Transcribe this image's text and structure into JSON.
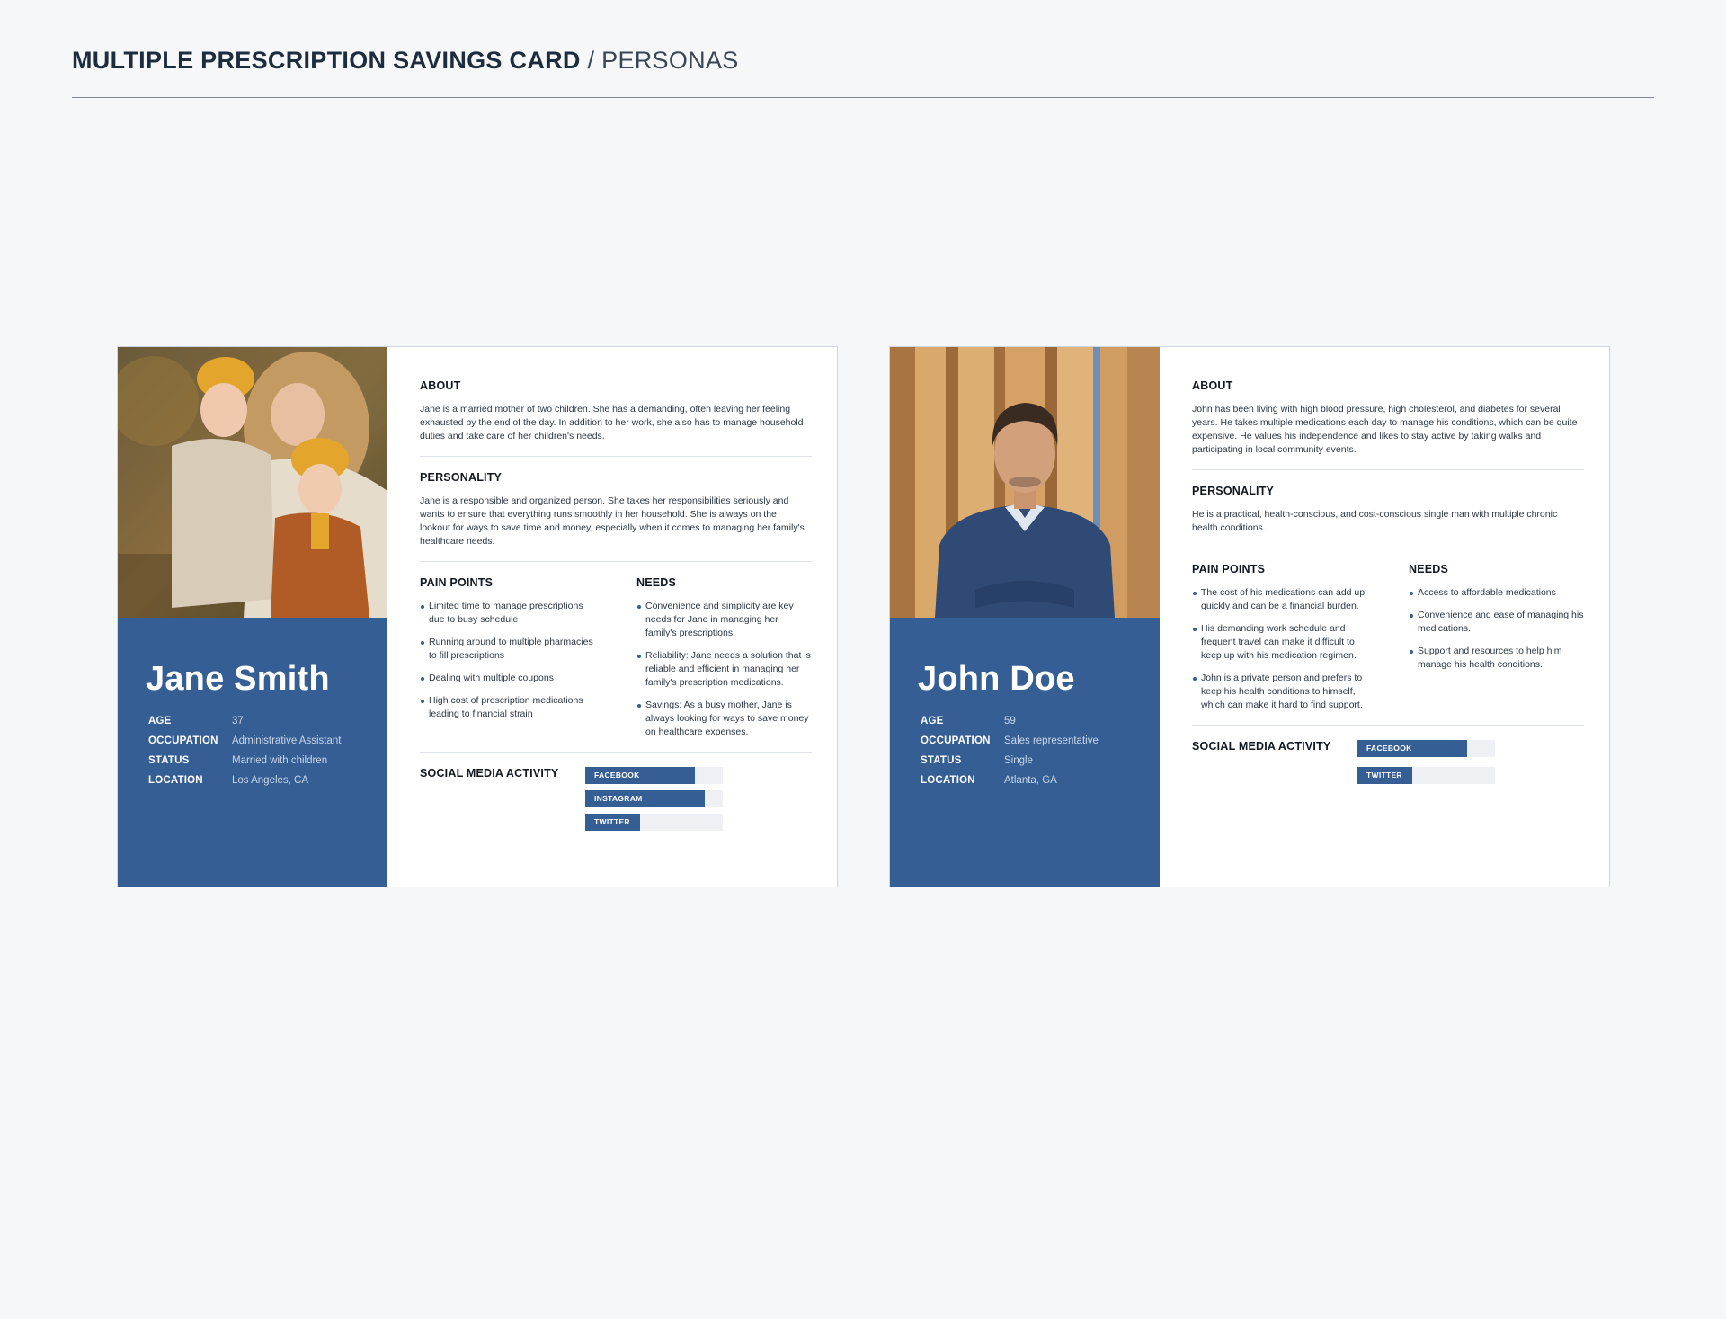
{
  "header": {
    "title_strong": "MULTIPLE PRESCRIPTION SAVINGS CARD",
    "title_light": " / PERSONAS"
  },
  "colors": {
    "accent": "#355e94",
    "background": "#f6f7f9",
    "card": "#ffffff"
  },
  "labels": {
    "age": "AGE",
    "occupation": "OCCUPATION",
    "status": "STATUS",
    "location": "LOCATION",
    "about": "ABOUT",
    "personality": "PERSONALITY",
    "pain_points": "PAIN POINTS",
    "needs": "NEEDS",
    "social": "SOCIAL MEDIA ACTIVITY"
  },
  "personas": [
    {
      "name": "Jane Smith",
      "photo": "mother-with-two-children-photo",
      "age": "37",
      "occupation": "Administrative Assistant",
      "status": "Married with children",
      "location": "Los Angeles, CA",
      "about": "Jane is a married mother of two children. She has a demanding, often leaving her feeling exhausted by the end of the day. In addition to her work, she also has to manage household duties and take care of her children's needs.",
      "personality": "Jane is a responsible and organized person. She takes her responsibilities seriously and wants to ensure that everything runs smoothly in her household. She is always on the lookout for ways to save time and money, especially when it comes to managing her family's healthcare needs.",
      "pain_points": [
        "Limited time to manage prescriptions due to busy schedule",
        "Running around to multiple pharmacies to fill prescriptions",
        "Dealing with multiple coupons",
        "High cost of prescription medications leading to financial strain"
      ],
      "needs": [
        "Convenience and simplicity are key needs for Jane in managing her family's prescriptions.",
        "Reliability: Jane needs a solution that is reliable and efficient in managing her family's prescription medications.",
        "Savings: As a busy mother, Jane is always looking for ways to save money on healthcare expenses."
      ],
      "social": [
        {
          "label": "FACEBOOK",
          "level": 0.8
        },
        {
          "label": "INSTAGRAM",
          "level": 0.87
        },
        {
          "label": "TWITTER",
          "level": 0.4
        }
      ]
    },
    {
      "name": "John Doe",
      "photo": "man-in-blue-sweater-photo",
      "age": "59",
      "occupation": "Sales representative",
      "status": "Single",
      "location": "Atlanta, GA",
      "about": "John has been living with high blood pressure, high cholesterol, and diabetes for several years. He takes multiple medications each day to manage his conditions, which can be quite expensive. He values his independence and likes to stay active by taking walks and participating in local community events.",
      "personality": "He is a practical, health-conscious, and cost-conscious single man with multiple chronic health conditions.",
      "pain_points": [
        "The cost of his medications can add up quickly and can be a financial burden.",
        "His demanding work schedule and frequent travel can make it difficult to keep up with his medication regimen.",
        "John is a private person and prefers to keep his health conditions to himself, which can make it hard to find support."
      ],
      "needs": [
        "Access to affordable medications",
        "Convenience and ease of managing his medications.",
        "Support and resources to help him manage his health conditions."
      ],
      "social": [
        {
          "label": "FACEBOOK",
          "level": 0.8
        },
        {
          "label": "TWITTER",
          "level": 0.4
        }
      ]
    }
  ]
}
